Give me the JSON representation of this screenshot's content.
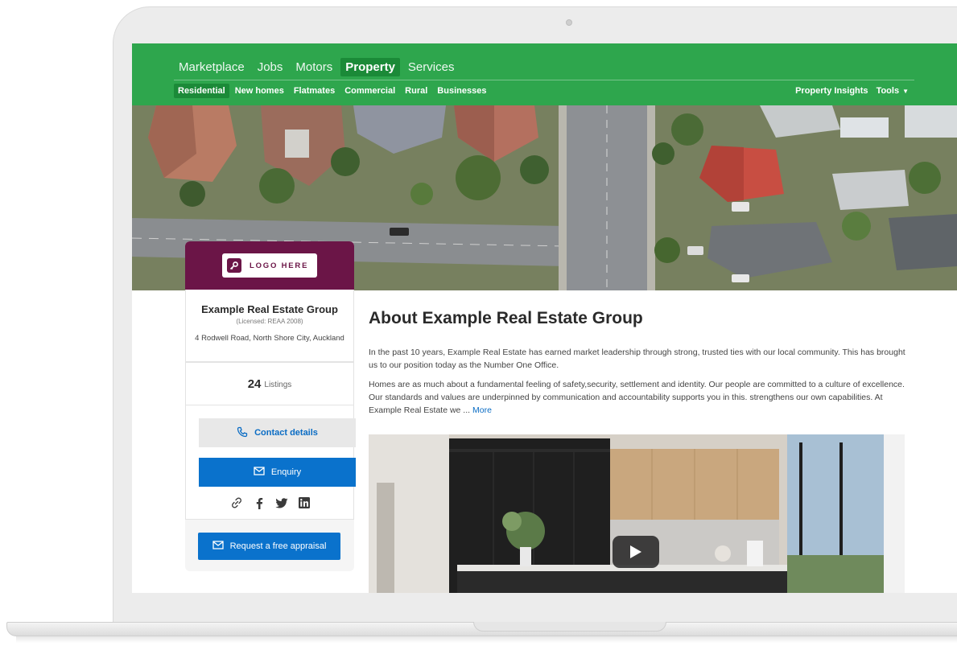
{
  "nav": {
    "main": [
      {
        "label": "Marketplace",
        "active": false
      },
      {
        "label": "Jobs",
        "active": false
      },
      {
        "label": "Motors",
        "active": false
      },
      {
        "label": "Property",
        "active": true
      },
      {
        "label": "Services",
        "active": false
      }
    ],
    "sub": [
      {
        "label": "Residential",
        "active": true
      },
      {
        "label": "New homes",
        "active": false
      },
      {
        "label": "Flatmates",
        "active": false
      },
      {
        "label": "Commercial",
        "active": false
      },
      {
        "label": "Rural",
        "active": false
      },
      {
        "label": "Businesses",
        "active": false
      }
    ],
    "right": {
      "insights": "Property Insights",
      "tools": "Tools"
    }
  },
  "agency": {
    "logo_text": "LOGO HERE",
    "name": "Example Real Estate Group",
    "license": "(Licensed: REAA 2008)",
    "address": "4 Rodwell Road, North Shore City, Auckland",
    "listings_count": "24",
    "listings_label": "Listings",
    "contact_label": "Contact details",
    "enquiry_label": "Enquiry",
    "appraisal_label": "Request a free appraisal"
  },
  "about": {
    "title": "About Example Real Estate Group",
    "p1": "In the past 10 years, Example Real Estate has earned market leadership through strong, trusted ties with our local community. This has brought us to our position today as the Number One Office.",
    "p2": "Homes are as much about a fundamental feeling of safety,security, settlement and identity. Our people are committed to a culture of excellence. Our standards and values are underpinned by communication and accountability supports you in this. strengthens our own capabilities. At Example Real Estate we ...",
    "more": "More"
  },
  "colors": {
    "brand_green": "#2ea64d",
    "active_green": "#1b8a38",
    "agency_purple": "#6b1547",
    "action_blue": "#0a72cc"
  },
  "icons": [
    "phone-icon",
    "mail-icon",
    "link-icon",
    "facebook-icon",
    "twitter-icon",
    "linkedin-icon",
    "key-icon",
    "play-icon",
    "caret-down-icon"
  ]
}
